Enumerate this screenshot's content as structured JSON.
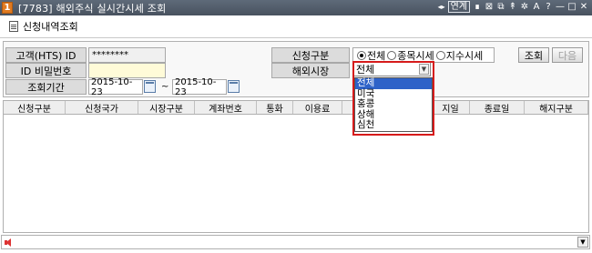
{
  "window": {
    "number": "1",
    "title": "[7783] 해외주식 실시간시세 조회",
    "titlebar_buttons": [
      "연계",
      "∎",
      "⊠",
      "⧉",
      "↟",
      "✲",
      "A",
      "?",
      "—",
      "□",
      "✕"
    ],
    "arrows": "◂▸"
  },
  "subtitle": "신청내역조회",
  "form": {
    "account_label": "고객(HTS) ID",
    "account_value": "********",
    "password_label": "ID 비밀번호",
    "password_value": "",
    "period_label": "조회기간",
    "date_from": "2015-10-23",
    "date_to": "2015-10-23",
    "tilde": "~",
    "apply_type_label": "신청구분",
    "apply_options": [
      "전체",
      "종목시세",
      "지수시세"
    ],
    "apply_selected": "전체",
    "market_label": "해외시장",
    "market_selected": "전체",
    "market_options": [
      "전체",
      "미국",
      "홍콩",
      "상해",
      "심천"
    ]
  },
  "buttons": {
    "search": "조회",
    "next": "다음"
  },
  "table": {
    "columns": [
      "신청구분",
      "신청국가",
      "시장구분",
      "계좌번호",
      "통화",
      "이용료",
      "",
      "",
      "지일",
      "종료일",
      "해지구분"
    ]
  },
  "colors": {
    "highlight_frame": "#d61b1b",
    "dropdown_selection": "#2e62c8",
    "input_bg": "#fffbd8"
  }
}
